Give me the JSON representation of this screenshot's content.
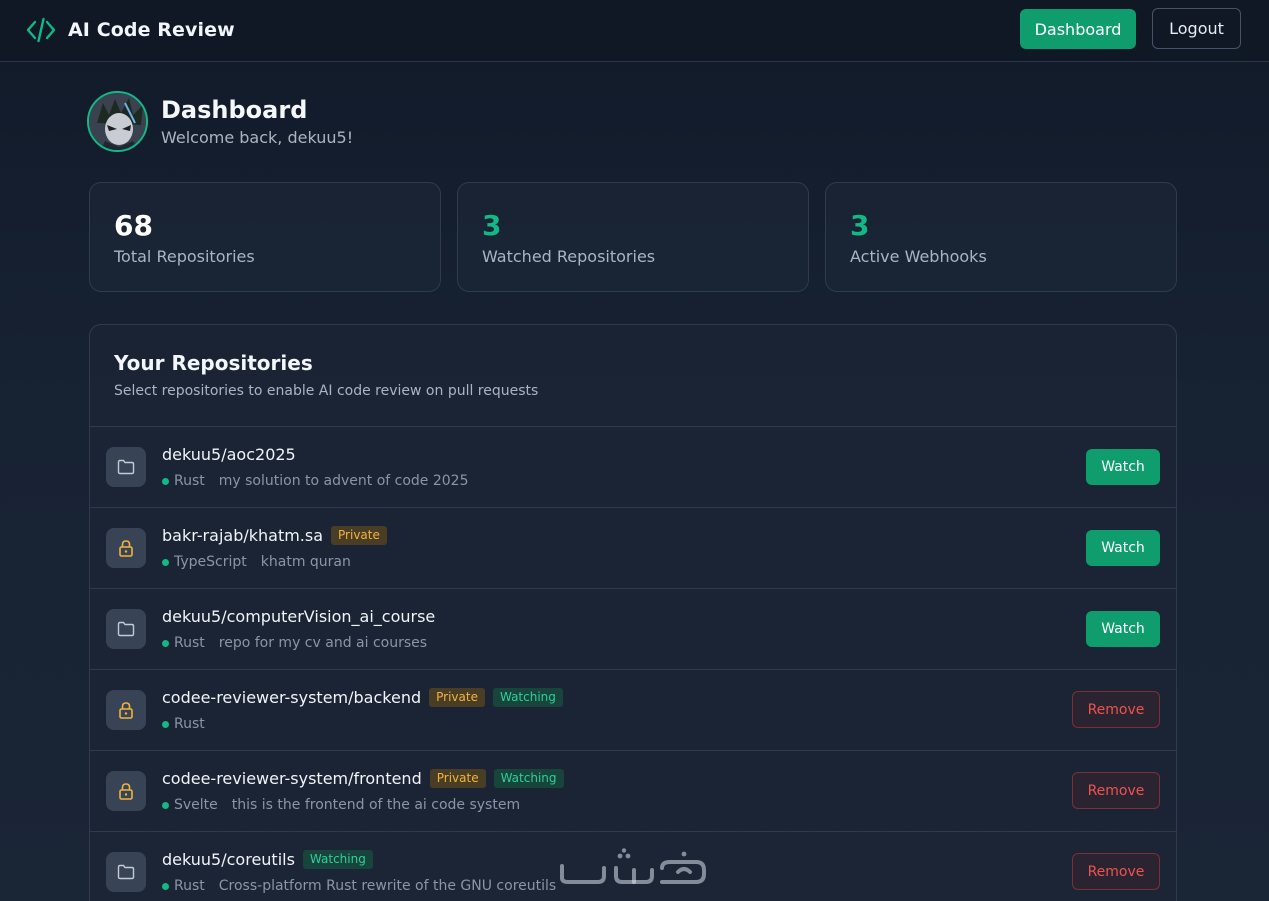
{
  "header": {
    "app_title": "AI Code Review",
    "dashboard_label": "Dashboard",
    "logout_label": "Logout"
  },
  "profile": {
    "title": "Dashboard",
    "welcome": "Welcome back, dekuu5!"
  },
  "stats": [
    {
      "value": "68",
      "label": "Total Repositories",
      "color": "#ffffff"
    },
    {
      "value": "3",
      "label": "Watched Repositories",
      "color": "#12b886"
    },
    {
      "value": "3",
      "label": "Active Webhooks",
      "color": "#12b886"
    }
  ],
  "repos_panel": {
    "title": "Your Repositories",
    "subtitle": "Select repositories to enable AI code review on pull requests"
  },
  "repos": [
    {
      "name": "dekuu5/aoc2025",
      "icon": "folder-icon",
      "language": "Rust",
      "description": "my solution to advent of code 2025",
      "private_label": "",
      "watching_label": "",
      "action": "Watch"
    },
    {
      "name": "bakr-rajab/khatm.sa",
      "icon": "lock-icon",
      "language": "TypeScript",
      "description": "khatm quran",
      "private_label": "Private",
      "watching_label": "",
      "action": "Watch"
    },
    {
      "name": "dekuu5/computerVision_ai_course",
      "icon": "folder-icon",
      "language": "Rust",
      "description": "repo for my cv and ai courses",
      "private_label": "",
      "watching_label": "",
      "action": "Watch"
    },
    {
      "name": "codee-reviewer-system/backend",
      "icon": "lock-icon",
      "language": "Rust",
      "description": "",
      "private_label": "Private",
      "watching_label": "Watching",
      "action": "Remove"
    },
    {
      "name": "codee-reviewer-system/frontend",
      "icon": "lock-icon",
      "language": "Svelte",
      "description": "this is the frontend of the ai code system",
      "private_label": "Private",
      "watching_label": "Watching",
      "action": "Remove"
    },
    {
      "name": "dekuu5/coreutils",
      "icon": "folder-icon",
      "language": "Rust",
      "description": "Cross-platform Rust rewrite of the GNU coreutils",
      "private_label": "",
      "watching_label": "Watching",
      "action": "Remove"
    }
  ],
  "colors": {
    "accent": "#0f9d6e",
    "private_badge": "#f0b43c",
    "watching_badge": "#2fcf9a",
    "remove": "#ef5350"
  },
  "watermark": "خمسات"
}
